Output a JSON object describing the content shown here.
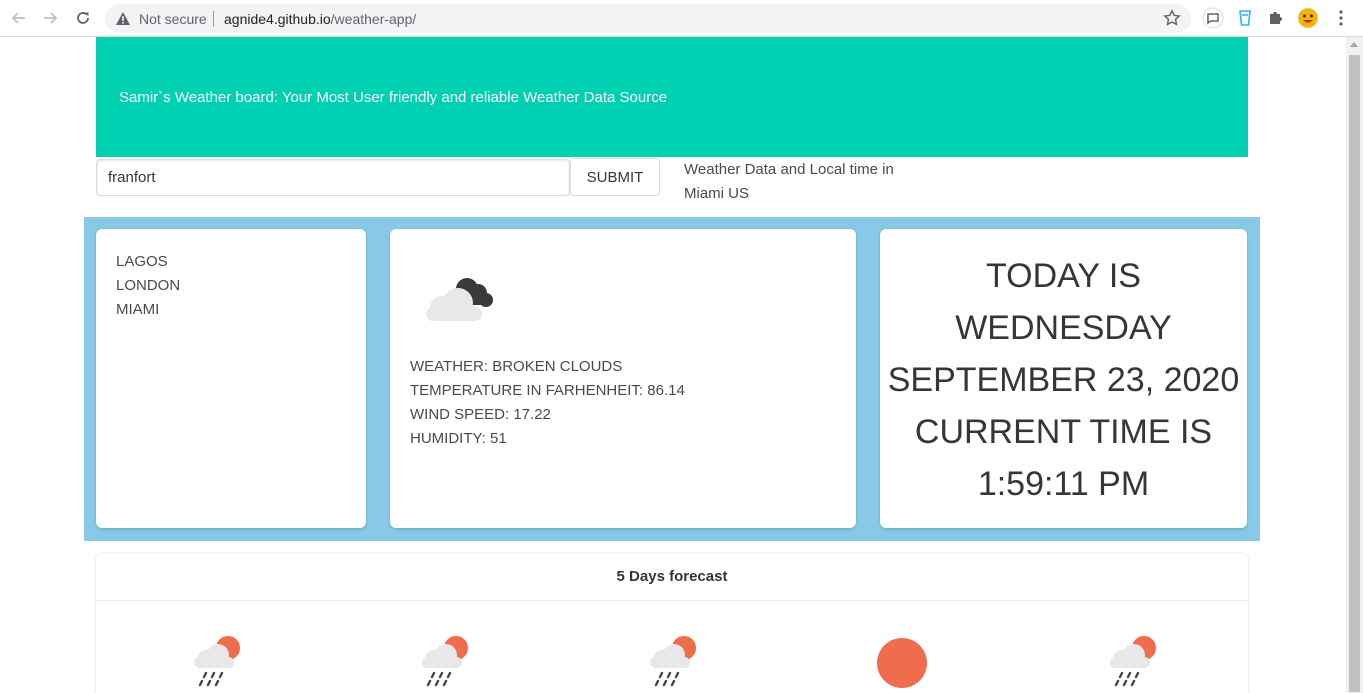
{
  "browser": {
    "security_label": "Not secure",
    "url_host": "agnide4.github.io",
    "url_path": "/weather-app/"
  },
  "banner": {
    "title": "Samir`s Weather board: Your Most User friendly and reliable Weather Data Source"
  },
  "search": {
    "value": "franfort",
    "submit_label": "SUBMIT"
  },
  "location_caption": {
    "line1": "Weather Data and Local time in",
    "line2": "Miami US"
  },
  "cities": [
    "LAGOS",
    "LONDON",
    "MIAMI"
  ],
  "current_weather": {
    "icon": "broken-clouds-icon",
    "weather": "WEATHER: BROKEN CLOUDS",
    "temperature": "TEMPERATURE IN FARHENHEIT: 86.14",
    "wind": "WIND SPEED: 17.22",
    "humidity": "HUMIDITY: 51"
  },
  "clock": {
    "line1": "TODAY IS",
    "line2": "WEDNESDAY",
    "line3": "SEPTEMBER 23, 2020",
    "line4": "CURRENT TIME IS",
    "line5": "1:59:11 PM"
  },
  "forecast": {
    "title": "5 Days forecast",
    "days": [
      {
        "icon": "rain-sun-icon"
      },
      {
        "icon": "rain-sun-icon"
      },
      {
        "icon": "rain-sun-icon"
      },
      {
        "icon": "sun-icon"
      },
      {
        "icon": "rain-sun-icon"
      }
    ]
  },
  "colors": {
    "banner": "#00d1b2",
    "panel": "#87c9e6",
    "sun": "#ef6c4c",
    "cloud": "#e8e8e8",
    "dark_cloud": "#3a3a3a"
  }
}
